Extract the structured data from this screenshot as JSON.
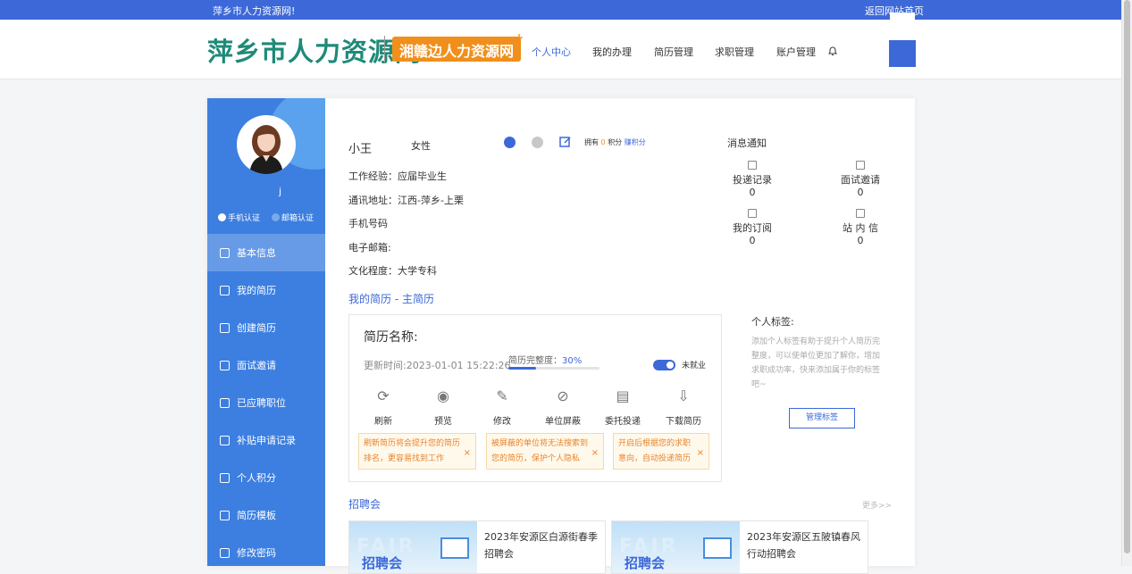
{
  "topbar": {
    "welcome": "萍乡市人力资源网!",
    "back_link": "返回网站首页"
  },
  "logo": {
    "main": "萍乡市人力资源网",
    "sub": "湘赣边人力资源网",
    "plus": "+"
  },
  "nav": [
    "个人中心",
    "我的办理",
    "简历管理",
    "求职管理",
    "账户管理"
  ],
  "sidebar": {
    "username": "j",
    "phone_cert": "手机认证",
    "email_cert": "邮箱认证",
    "menu": [
      "基本信息",
      "我的简历",
      "创建简历",
      "面试邀请",
      "已应聘职位",
      "补贴申请记录",
      "个人积分",
      "简历模板",
      "修改密码"
    ]
  },
  "profile": {
    "name": "小王",
    "gender": "女性",
    "points_prefix": "拥有",
    "points_value": "0",
    "points_unit": "积分",
    "earn_points": "赚积分",
    "work_exp": "工作经验：应届毕业生",
    "address": "通讯地址：江西-萍乡-上栗",
    "phone": "手机号码",
    "email": "电子邮箱:",
    "education": "文化程度：大学专科"
  },
  "messages": {
    "title": "消息通知",
    "items": [
      {
        "label": "投递记录",
        "count": "0"
      },
      {
        "label": "面试邀请",
        "count": "0"
      },
      {
        "label": "我的订阅",
        "count": "0"
      },
      {
        "label": "站 内 信",
        "count": "0"
      }
    ]
  },
  "resume": {
    "section_title": "我的简历 - 主简历",
    "name_label": "简历名称:",
    "update_time": "更新时间:2023-01-01 15:22:26",
    "completeness_label": "简历完整度：",
    "completeness_value": "30%",
    "completeness": 0.3,
    "status": "未就业",
    "actions": [
      "刷新",
      "预览",
      "修改",
      "单位屏蔽",
      "委托投递",
      "下载简历"
    ],
    "tips": [
      "刷新简历将会提升您的简历排名，更容易找到工作",
      "被屏蔽的单位将无法搜索到您的简历，保护个人隐私",
      "开启后根据您的求职意向，自动投递简历"
    ]
  },
  "tags": {
    "title": "个人标签:",
    "desc": "添加个人标签有助于提升个人简历完整度，可以使单位更加了解你，增加求职成功率，快来添加属于你的标签吧~",
    "button": "管理标签"
  },
  "fairs": {
    "title": "招聘会",
    "more": "更多>>",
    "image_text": "招聘会",
    "image_bg_text": "FAIR",
    "items": [
      {
        "title": "2023年安源区白源街春季招聘会"
      },
      {
        "title": "2023年安源区五陂镇春风行动招聘会"
      }
    ]
  },
  "colors": {
    "brand": "#3d68d8",
    "logo_green": "#1f8a78",
    "logo_orange": "#f18f1c",
    "sidebar": "#3d7fe0",
    "tip": "#e8842c"
  }
}
